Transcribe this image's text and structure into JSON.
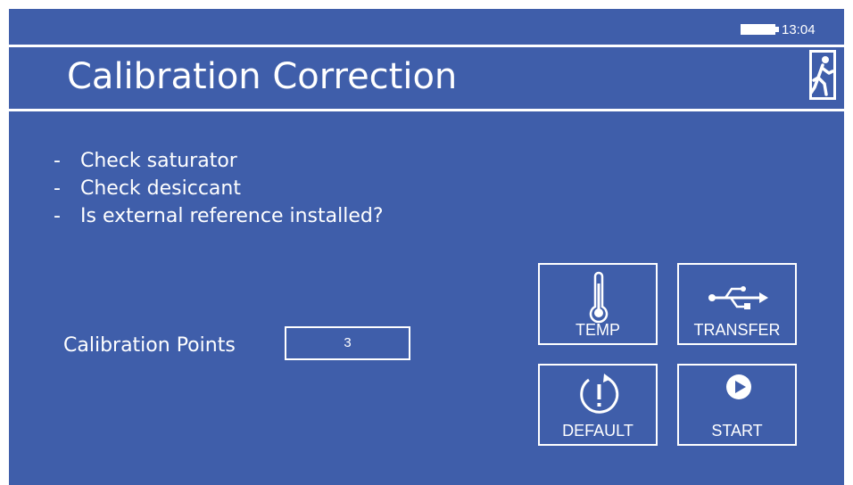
{
  "status": {
    "time": "13:04",
    "battery_icon": "battery-full-icon"
  },
  "header": {
    "title": "Calibration Correction",
    "exit_icon": "exit-running-man-icon"
  },
  "checklist": {
    "items": [
      "Check saturator",
      "Check desiccant",
      "Is external reference installed?"
    ]
  },
  "calibration_points": {
    "label": "Calibration Points",
    "value": "3"
  },
  "actions": {
    "temp": {
      "label": "TEMP",
      "icon": "thermometer-icon"
    },
    "transfer": {
      "label": "TRANSFER",
      "icon": "usb-icon"
    },
    "default": {
      "label": "DEFAULT",
      "icon": "reset-alert-icon"
    },
    "start": {
      "label": "START",
      "icon": "play-icon"
    }
  },
  "colors": {
    "background": "#3f5eaa",
    "foreground": "#ffffff"
  }
}
